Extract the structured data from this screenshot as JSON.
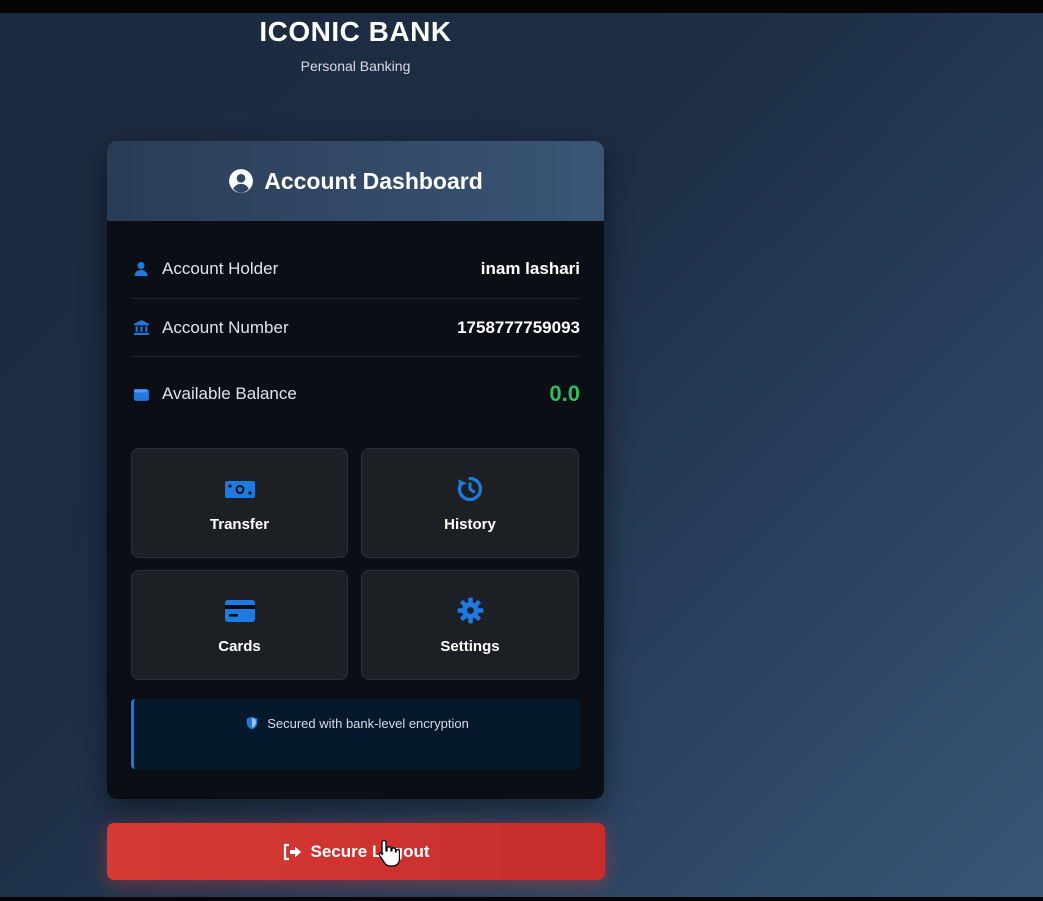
{
  "brand": {
    "title": "ICONIC BANK",
    "subtitle": "Personal Banking"
  },
  "dashboard": {
    "header_icon": "user-circle-icon",
    "title": "Account Dashboard",
    "rows": [
      {
        "icon": "user-icon",
        "label": "Account Holder",
        "value": "inam lashari"
      },
      {
        "icon": "bank-icon",
        "label": "Account Number",
        "value": "1758777759093"
      },
      {
        "icon": "wallet-icon",
        "label": "Available Balance",
        "value": "0.0"
      }
    ],
    "actions": [
      {
        "icon": "money-bill-icon",
        "label": "Transfer"
      },
      {
        "icon": "history-icon",
        "label": "History"
      },
      {
        "icon": "credit-card-icon",
        "label": "Cards"
      },
      {
        "icon": "gear-icon",
        "label": "Settings"
      }
    ],
    "security_notice": "Secured with bank-level encryption"
  },
  "logout": {
    "icon": "sign-out-icon",
    "label": "Secure Logout"
  },
  "colors": {
    "accent_blue": "#1f7ae0",
    "balance_green": "#2ebd59",
    "logout_red": "#d63a35"
  }
}
